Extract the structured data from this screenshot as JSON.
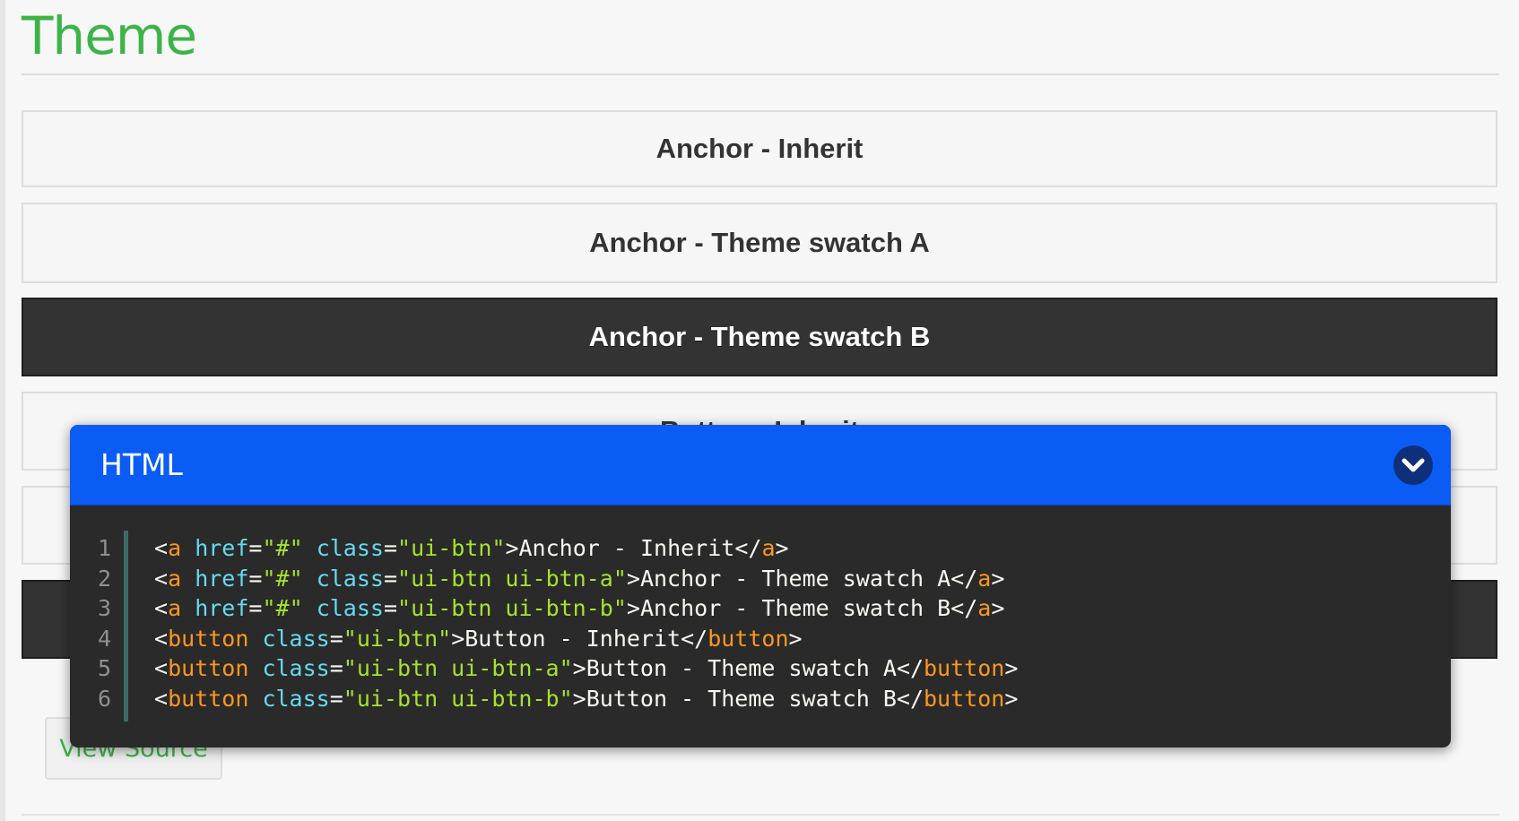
{
  "page": {
    "title": "Theme",
    "accent_color": "#3cb447"
  },
  "buttons": [
    {
      "label": "Anchor - Inherit",
      "swatch": "inherit"
    },
    {
      "label": "Anchor - Theme swatch A",
      "swatch": "a"
    },
    {
      "label": "Anchor - Theme swatch B",
      "swatch": "b"
    },
    {
      "label": "Button - Inherit",
      "swatch": "inherit"
    },
    {
      "label": "",
      "swatch": "a"
    },
    {
      "label": "",
      "swatch": "b"
    }
  ],
  "view_source": {
    "label": "View Source"
  },
  "popup": {
    "title": "HTML",
    "header_color": "#0a5cf5",
    "collapse_icon": "chevron-down-icon",
    "lines": [
      {
        "number": "1",
        "tag": "a",
        "attrs": [
          [
            "href",
            "\"#\""
          ],
          [
            "class",
            "\"ui-btn\""
          ]
        ],
        "text": "Anchor - Inherit"
      },
      {
        "number": "2",
        "tag": "a",
        "attrs": [
          [
            "href",
            "\"#\""
          ],
          [
            "class",
            "\"ui-btn ui-btn-a\""
          ]
        ],
        "text": "Anchor - Theme swatch A"
      },
      {
        "number": "3",
        "tag": "a",
        "attrs": [
          [
            "href",
            "\"#\""
          ],
          [
            "class",
            "\"ui-btn ui-btn-b\""
          ]
        ],
        "text": "Anchor - Theme swatch B"
      },
      {
        "number": "4",
        "tag": "button",
        "attrs": [
          [
            "class",
            "\"ui-btn\""
          ]
        ],
        "text": "Button - Inherit"
      },
      {
        "number": "5",
        "tag": "button",
        "attrs": [
          [
            "class",
            "\"ui-btn ui-btn-a\""
          ]
        ],
        "text": "Button - Theme swatch A"
      },
      {
        "number": "6",
        "tag": "button",
        "attrs": [
          [
            "class",
            "\"ui-btn ui-btn-b\""
          ]
        ],
        "text": "Button - Theme swatch B"
      }
    ]
  }
}
